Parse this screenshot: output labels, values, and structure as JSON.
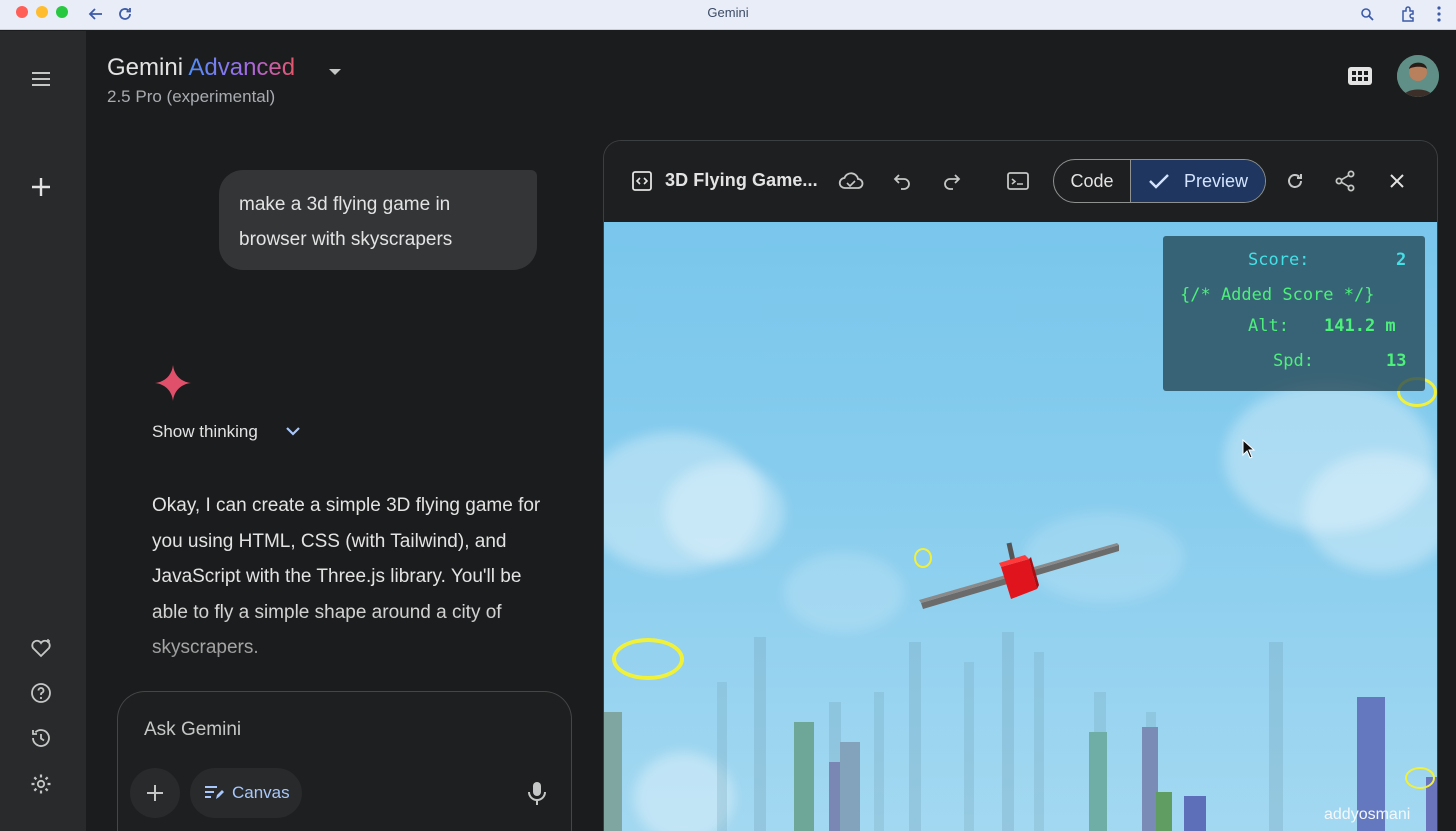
{
  "browser": {
    "title": "Gemini"
  },
  "header": {
    "brand_main": "Gemini",
    "brand_tier": "Advanced",
    "model": "2.5 Pro (experimental)"
  },
  "chat": {
    "user_message": "make a 3d flying game in browser with skyscrapers",
    "show_thinking": "Show thinking",
    "reply": "Okay, I can create a simple 3D flying game for you using HTML, CSS (with Tailwind), and JavaScript with the Three.js library. You'll be able to fly a simple shape around a city of skyscrapers."
  },
  "input": {
    "placeholder": "Ask Gemini",
    "canvas_label": "Canvas"
  },
  "canvas": {
    "title": "3D Flying Game...",
    "code_tab": "Code",
    "preview_tab": "Preview",
    "active_tab": "Preview"
  },
  "game": {
    "score_label": "Score:",
    "score_value": "2",
    "comment": "{/* Added Score */}",
    "alt_label": "Alt:",
    "alt_value": "141.2 m",
    "spd_label": "Spd:",
    "spd_value": "13"
  },
  "watermark": "addyosmani",
  "colors": {
    "background": "#1b1c1d",
    "rail": "#282a2c",
    "accent": "#a8c7fa",
    "hud_cyan": "#43e0e6",
    "hud_green": "#4cf07a",
    "ring": "#f1f13a",
    "plane": "#e0141c"
  }
}
